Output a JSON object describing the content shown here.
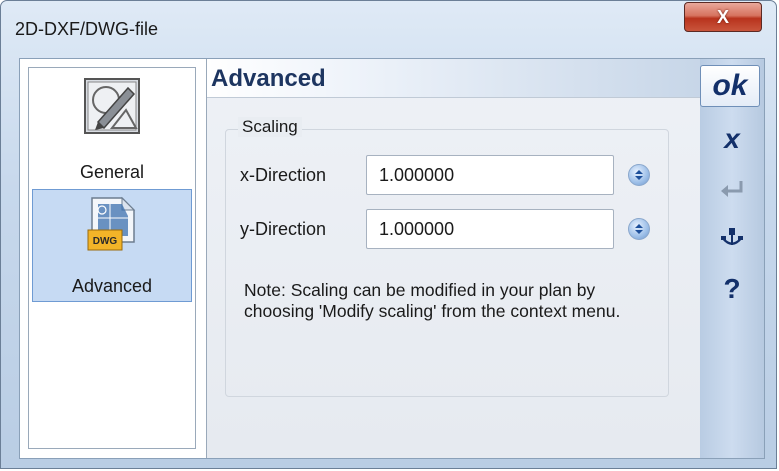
{
  "window": {
    "title": "2D-DXF/DWG-file",
    "close_label": "X"
  },
  "sidebar": {
    "items": [
      {
        "label": "General",
        "icon": "general-settings-icon"
      },
      {
        "label": "Advanced",
        "icon": "dwg-file-icon",
        "icon_badge": "DWG",
        "selected": true
      }
    ]
  },
  "panel": {
    "title": "Advanced",
    "group_label": "Scaling",
    "x_direction": {
      "label": "x-Direction",
      "value": "1.000000"
    },
    "y_direction": {
      "label": "y-Direction",
      "value": "1.000000"
    },
    "note": "Note: Scaling can be modified in your plan by choosing 'Modify scaling' from the context menu."
  },
  "toolbar": {
    "ok_label": "ok",
    "cancel_label": "x",
    "help_label": "?"
  },
  "colors": {
    "accent": "#13306a",
    "selected_bg": "#c6daf3",
    "close_button": "#c9553c"
  }
}
